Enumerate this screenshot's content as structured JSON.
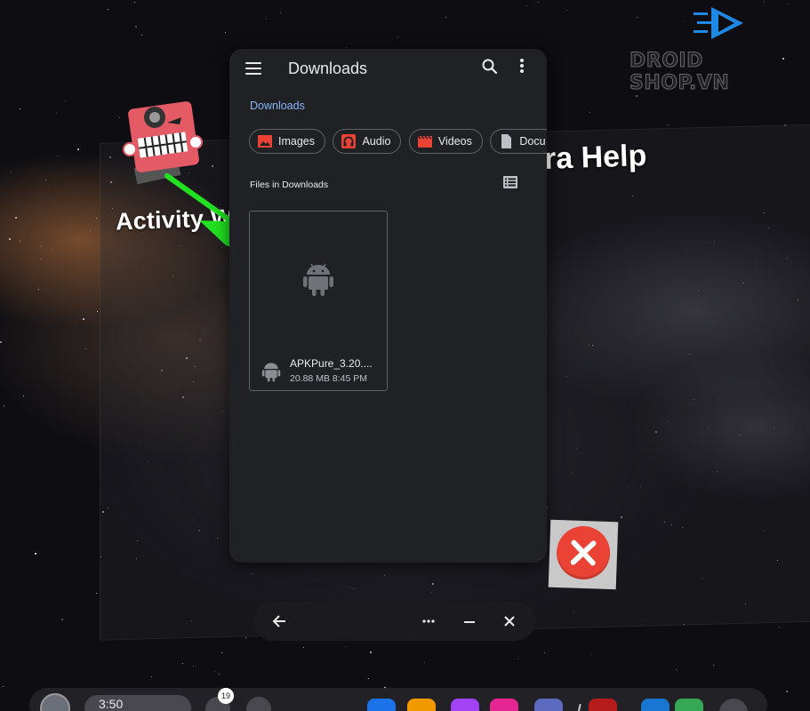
{
  "background": {
    "activity_label": "Activity Wi",
    "help_label": "ra Help"
  },
  "watermark": {
    "brand": "DROID SHOP.VN"
  },
  "dialog": {
    "title": "Downloads",
    "breadcrumb": "Downloads",
    "chips": [
      {
        "label": "Images",
        "icon": "image-icon",
        "color": "#ea4335"
      },
      {
        "label": "Audio",
        "icon": "headphones-icon",
        "color": "#ea4335"
      },
      {
        "label": "Videos",
        "icon": "video-icon",
        "color": "#ea4335"
      },
      {
        "label": "Docu",
        "icon": "document-icon",
        "color": "#bdc1c6"
      }
    ],
    "section_label": "Files in Downloads",
    "files": [
      {
        "name": "APKPure_3.20....",
        "size": "20.88 MB",
        "time": "8:45 PM",
        "meta": "20.88 MB 8:45 PM",
        "icon": "android-icon"
      }
    ]
  },
  "dock": {
    "time": "3:50",
    "notification_count": "19",
    "apps": [
      {
        "name": "app-blue",
        "color": "#1a73e8"
      },
      {
        "name": "app-orange",
        "color": "#f29900"
      },
      {
        "name": "app-purple",
        "color": "#a142f4"
      },
      {
        "name": "app-pink",
        "color": "#e52592"
      },
      {
        "name": "app-indigo",
        "color": "#5c6bc0"
      },
      {
        "name": "app-game",
        "color": "#b71c1c"
      },
      {
        "name": "app-blue2",
        "color": "#1976d2"
      },
      {
        "name": "app-green",
        "color": "#34a853"
      }
    ]
  },
  "colors": {
    "accent": "#8ab4f8",
    "dialog_bg": "#202124",
    "arrow": "#22e022",
    "close_red": "#ea4335"
  }
}
